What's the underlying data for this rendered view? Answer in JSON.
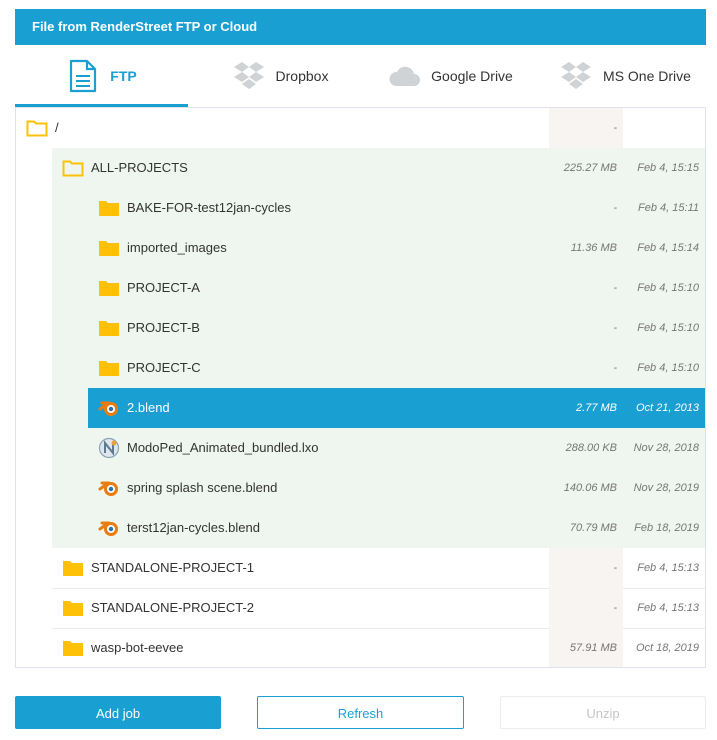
{
  "header": {
    "title": "File from RenderStreet FTP or Cloud"
  },
  "tabs": [
    {
      "label": "FTP",
      "icon": "document-icon",
      "active": true
    },
    {
      "label": "Dropbox",
      "icon": "dropbox-icon",
      "active": false
    },
    {
      "label": "Google Drive",
      "icon": "cloud-icon",
      "active": false
    },
    {
      "label": "MS One Drive",
      "icon": "dropbox-icon",
      "active": false
    }
  ],
  "tree": {
    "root": {
      "name": "/",
      "size": "-",
      "date": ""
    },
    "rows": [
      {
        "name": "ALL-PROJECTS",
        "size": "225.27 MB",
        "date": "Feb 4, 15:15",
        "type": "folder-open"
      },
      {
        "name": "BAKE-FOR-test12jan-cycles",
        "size": "-",
        "date": "Feb 4, 15:11",
        "type": "folder"
      },
      {
        "name": "imported_images",
        "size": "11.36 MB",
        "date": "Feb 4, 15:14",
        "type": "folder"
      },
      {
        "name": "PROJECT-A",
        "size": "-",
        "date": "Feb 4, 15:10",
        "type": "folder"
      },
      {
        "name": "PROJECT-B",
        "size": "-",
        "date": "Feb 4, 15:10",
        "type": "folder"
      },
      {
        "name": "PROJECT-C",
        "size": "-",
        "date": "Feb 4, 15:10",
        "type": "folder"
      },
      {
        "name": "2.blend",
        "size": "2.77 MB",
        "date": "Oct 21, 2013",
        "type": "blender"
      },
      {
        "name": "ModoPed_Animated_bundled.lxo",
        "size": "288.00 KB",
        "date": "Nov 28, 2018",
        "type": "modo"
      },
      {
        "name": "spring splash scene.blend",
        "size": "140.06 MB",
        "date": "Nov 28, 2019",
        "type": "blender"
      },
      {
        "name": "terst12jan-cycles.blend",
        "size": "70.79 MB",
        "date": "Feb 18, 2019",
        "type": "blender"
      },
      {
        "name": "STANDALONE-PROJECT-1",
        "size": "-",
        "date": "Feb 4, 15:13",
        "type": "folder"
      },
      {
        "name": "STANDALONE-PROJECT-2",
        "size": "-",
        "date": "Feb 4, 15:13",
        "type": "folder"
      },
      {
        "name": "wasp-bot-eevee",
        "size": "57.91 MB",
        "date": "Oct 18, 2019",
        "type": "folder"
      }
    ]
  },
  "buttons": {
    "add_job": "Add job",
    "refresh": "Refresh",
    "unzip": "Unzip"
  },
  "colors": {
    "accent": "#1a9fd3",
    "folder": "#ffc107",
    "nested_bg": "#eef6ef",
    "blender": "#e87d0d"
  }
}
